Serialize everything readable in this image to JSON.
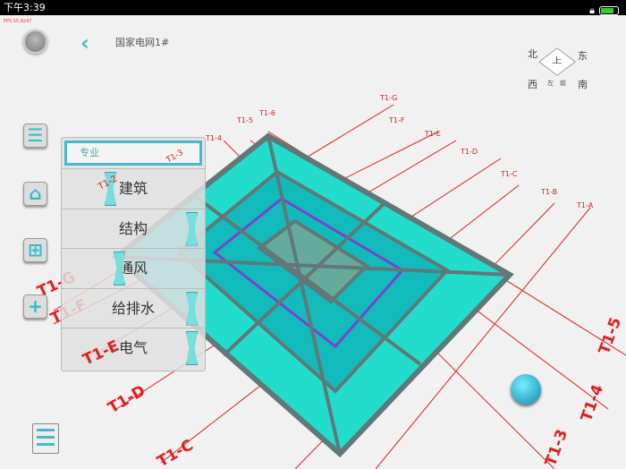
{
  "status_bar": {
    "time": "下午3:39"
  },
  "fps": "FPS:15.8247",
  "header": {
    "title": "国家电网1#"
  },
  "compass": {
    "north": "北",
    "east": "东",
    "south": "南",
    "west": "西",
    "top": "上",
    "left": "左",
    "front": "前"
  },
  "discipline_panel": {
    "header": "专业",
    "items": [
      {
        "label": "建筑",
        "on": false
      },
      {
        "label": "结构",
        "on": true
      },
      {
        "label": "通风",
        "on": false
      },
      {
        "label": "给排水",
        "on": true
      },
      {
        "label": "电气",
        "on": true
      }
    ]
  },
  "grid_labels": {
    "letters": [
      "T1-G",
      "T1-F",
      "T1-E",
      "T1-D",
      "T1-C",
      "T1-B",
      "T1-A"
    ],
    "top_letters": [
      "T1-G",
      "T1-F",
      "T1-E",
      "T1-D",
      "T1-C",
      "T1-B",
      "T1-A"
    ],
    "numbers": [
      "T1-5",
      "T1-6",
      "T1-4",
      "T1-3",
      "T1-2"
    ],
    "left_labels": [
      "T1-G",
      "T1-F",
      "T1-E",
      "T1-D",
      "T1-C"
    ],
    "right_labels": [
      "T1-5",
      "T1-4",
      "T1-3"
    ]
  },
  "colors": {
    "accent": "#44bbcc",
    "grid": "#e02020",
    "model": "#22ddcc",
    "frame": "#607878"
  }
}
